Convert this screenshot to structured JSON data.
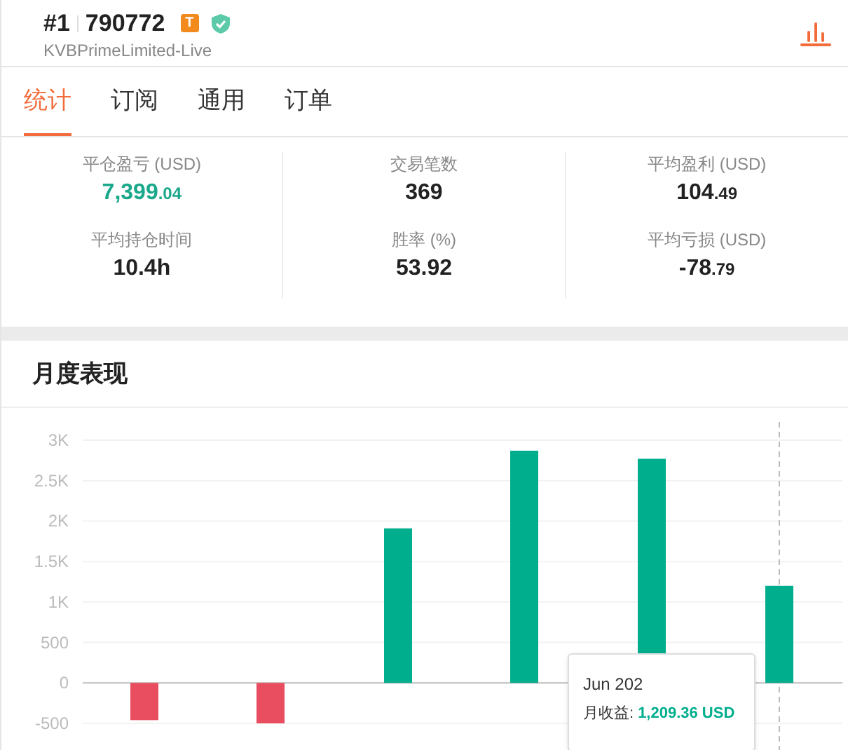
{
  "header": {
    "rank": "#1",
    "account": "790772",
    "badge": "T",
    "server": "KVBPrimeLimited-Live"
  },
  "tabs": [
    {
      "label": "统计",
      "selected": true
    },
    {
      "label": "订阅",
      "selected": false
    },
    {
      "label": "通用",
      "selected": false
    },
    {
      "label": "订单",
      "selected": false
    }
  ],
  "stats": [
    {
      "label": "平仓盈亏 (USD)",
      "value": "7,399.04",
      "kind": "money",
      "positive": true
    },
    {
      "label": "交易笔数",
      "value": "369",
      "kind": "plain",
      "positive": false
    },
    {
      "label": "平均盈利 (USD)",
      "value": "104.49",
      "kind": "money",
      "positive": false
    },
    {
      "label": "平均持仓时间",
      "value": "10.4h",
      "kind": "plain",
      "positive": false
    },
    {
      "label": "胜率 (%)",
      "value": "53.92",
      "kind": "plain",
      "positive": false
    },
    {
      "label": "平均亏损 (USD)",
      "value": "-78.79",
      "kind": "money",
      "positive": false
    }
  ],
  "monthly": {
    "title": "月度表现",
    "chart_data": {
      "type": "bar",
      "stacked": true,
      "grid": true,
      "series": [
        {
          "color": "#00ae8e",
          "values": [
            null,
            null,
            1910,
            2870,
            2770,
            1200
          ]
        },
        {
          "color": "#e84e5f",
          "values": [
            -460,
            -500,
            null,
            null,
            null,
            null
          ]
        }
      ],
      "ylim": [
        -500,
        3000
      ],
      "yticks": [
        {
          "value": -500,
          "label": "-500"
        },
        {
          "value": 0,
          "label": "0"
        },
        {
          "value": 500,
          "label": "500"
        },
        {
          "value": 1000,
          "label": "1K"
        },
        {
          "value": 1500,
          "label": "1.5K"
        },
        {
          "value": 2000,
          "label": "2K"
        },
        {
          "value": 2500,
          "label": "2.5K"
        },
        {
          "value": 3000,
          "label": "3K"
        }
      ]
    },
    "tooltip": {
      "title": "Jun 202",
      "label": "月收益:",
      "value": "1,209.36 USD"
    }
  }
}
